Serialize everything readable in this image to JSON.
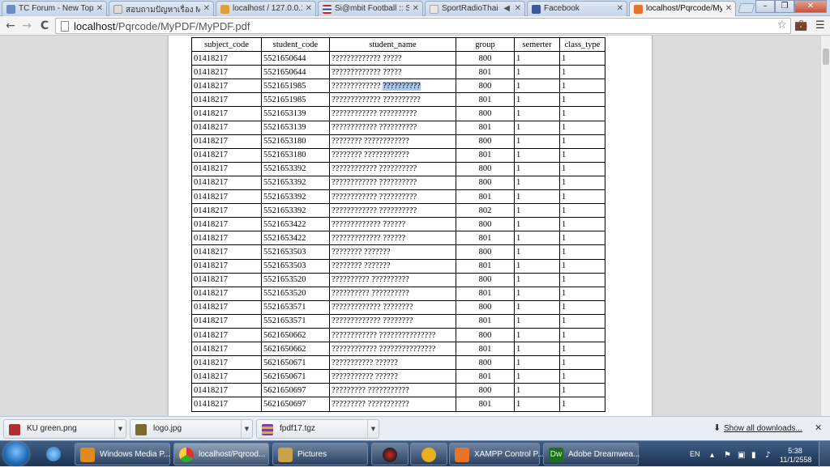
{
  "tabs": [
    {
      "title": "TC Forum - New Topic",
      "icon_color": "#6d8fbf",
      "active": false
    },
    {
      "title": "สอบถามปัญหาเรื่อง MYSQL",
      "icon_color": "#dcdcdc",
      "active": false
    },
    {
      "title": "localhost / 127.0.0.1 / ",
      "icon_color": "#e0a040",
      "active": false
    },
    {
      "title": "Si@mbit Football :: Sia",
      "icon_color": "#cc2030",
      "active": false
    },
    {
      "title": "SportRadioThai On",
      "icon_color": "#e8e8e8",
      "active": false
    },
    {
      "title": "Facebook",
      "icon_color": "#3b5998",
      "active": false
    },
    {
      "title": "localhost/Pqrcode/My",
      "icon_color": "#e8742c",
      "active": true
    }
  ],
  "window_buttons": {
    "minimize": "–",
    "restore": "❐",
    "close": "✕"
  },
  "toolbar": {
    "back": "←",
    "forward": "→",
    "reload": "C",
    "url_host": "localhost",
    "url_path": "/Pqrcode/MyPDF/MyPDF.pdf",
    "star": "☆"
  },
  "table": {
    "headers": [
      "subject_code",
      "student_code",
      "student_name",
      "group",
      "semerter",
      "class_type"
    ],
    "rows": [
      [
        "01418217",
        "5521650644",
        "????????????? ?????",
        "",
        "800",
        "1",
        "1"
      ],
      [
        "01418217",
        "5521650644",
        "????????????? ?????",
        "",
        "801",
        "1",
        "1"
      ],
      [
        "01418217",
        "5521651985",
        "????????????? ",
        "??????????",
        "800",
        "1",
        "1"
      ],
      [
        "01418217",
        "5521651985",
        "????????????? ??????????",
        "",
        "801",
        "1",
        "1"
      ],
      [
        "01418217",
        "5521653139",
        "???????????? ??????????",
        "",
        "800",
        "1",
        "1"
      ],
      [
        "01418217",
        "5521653139",
        "???????????? ??????????",
        "",
        "801",
        "1",
        "1"
      ],
      [
        "01418217",
        "5521653180",
        "???????? ????????????",
        "",
        "800",
        "1",
        "1"
      ],
      [
        "01418217",
        "5521653180",
        "???????? ????????????",
        "",
        "801",
        "1",
        "1"
      ],
      [
        "01418217",
        "5521653392",
        "???????????? ??????????",
        "",
        "800",
        "1",
        "1"
      ],
      [
        "01418217",
        "5521653392",
        "???????????? ??????????",
        "",
        "800",
        "1",
        "1"
      ],
      [
        "01418217",
        "5521653392",
        "???????????? ??????????",
        "",
        "801",
        "1",
        "1"
      ],
      [
        "01418217",
        "5521653392",
        "???????????? ??????????",
        "",
        "802",
        "1",
        "1"
      ],
      [
        "01418217",
        "5521653422",
        "????????????? ??????",
        "",
        "800",
        "1",
        "1"
      ],
      [
        "01418217",
        "5521653422",
        "????????????? ??????",
        "",
        "801",
        "1",
        "1"
      ],
      [
        "01418217",
        "5521653503",
        "???????? ???????",
        "",
        "800",
        "1",
        "1"
      ],
      [
        "01418217",
        "5521653503",
        "???????? ???????",
        "",
        "801",
        "1",
        "1"
      ],
      [
        "01418217",
        "5521653520",
        "?????????? ??????????",
        "",
        "800",
        "1",
        "1"
      ],
      [
        "01418217",
        "5521653520",
        "?????????? ??????????",
        "",
        "801",
        "1",
        "1"
      ],
      [
        "01418217",
        "5521653571",
        "????????????? ????????",
        "",
        "800",
        "1",
        "1"
      ],
      [
        "01418217",
        "5521653571",
        "????????????? ????????",
        "",
        "801",
        "1",
        "1"
      ],
      [
        "01418217",
        "5621650662",
        "???????????? ???????????????",
        "",
        "800",
        "1",
        "1"
      ],
      [
        "01418217",
        "5621650662",
        "???????????? ???????????????",
        "",
        "801",
        "1",
        "1"
      ],
      [
        "01418217",
        "5621650671",
        "??????????? ??????",
        "",
        "800",
        "1",
        "1"
      ],
      [
        "01418217",
        "5621650671",
        "??????????? ??????",
        "",
        "801",
        "1",
        "1"
      ],
      [
        "01418217",
        "5621650697",
        "????????? ???????????",
        "",
        "800",
        "1",
        "1"
      ],
      [
        "01418217",
        "5621650697",
        "????????? ???????????",
        "",
        "801",
        "1",
        "1"
      ]
    ]
  },
  "downloads": {
    "items": [
      {
        "name": "KU green.png",
        "icon_color": "#b03030"
      },
      {
        "name": "logo.jpg",
        "icon_color": "#7a6a30"
      },
      {
        "name": "fpdf17.tgz",
        "icon_color": "#7a3fa0"
      }
    ],
    "show_all": "Show all downloads...",
    "close": "✕"
  },
  "taskbar": {
    "apps": [
      {
        "label": "Windows Media P...",
        "icon_color": "#e08a20"
      },
      {
        "label": "localhost/Pqrcod...",
        "icon_color": "#3c9a3c"
      },
      {
        "label": "Pictures",
        "icon_color": "#c9a24a"
      },
      {
        "label": "",
        "icon_color": "#222222"
      },
      {
        "label": "",
        "icon_color": "#e6b020"
      },
      {
        "label": "XAMPP Control P...",
        "icon_color": "#e8742c"
      },
      {
        "label": "Adobe Dreamwea...",
        "icon_color": "#1f6e1f"
      }
    ],
    "pinned_icon_color": "#2a8ae0",
    "lang": "EN",
    "clock_time": "5:38",
    "clock_date": "11/1/2558"
  }
}
